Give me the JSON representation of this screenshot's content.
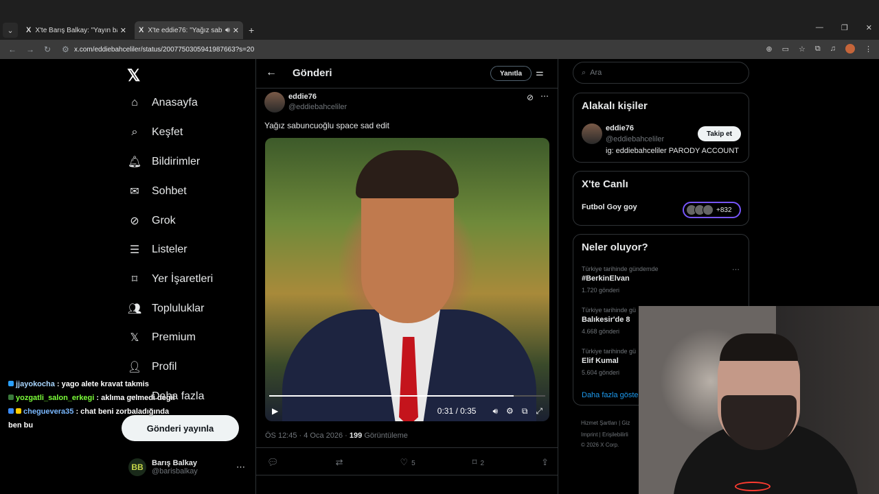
{
  "browser": {
    "tabs": [
      {
        "title": "X'te Barış Balkay: \"Yayın başladı",
        "active": false
      },
      {
        "title": "X'te eddie76: \"Yağız sabunc",
        "active": true
      }
    ],
    "url": "x.com/eddiebahceliler/status/2007750305941987663?s=20"
  },
  "sidebar": {
    "items": [
      {
        "label": "Anasayfa",
        "icon": "home-icon",
        "glyph": "⌂"
      },
      {
        "label": "Keşfet",
        "icon": "search-icon",
        "glyph": "⌕"
      },
      {
        "label": "Bildirimler",
        "icon": "bell-icon",
        "glyph": "🔔︎"
      },
      {
        "label": "Sohbet",
        "icon": "mail-icon",
        "glyph": "✉"
      },
      {
        "label": "Grok",
        "icon": "grok-icon",
        "glyph": "⊘"
      },
      {
        "label": "Listeler",
        "icon": "list-icon",
        "glyph": "☰"
      },
      {
        "label": "Yer İşaretleri",
        "icon": "bookmark-icon",
        "glyph": "⌑"
      },
      {
        "label": "Topluluklar",
        "icon": "people-icon",
        "glyph": "👥︎"
      },
      {
        "label": "Premium",
        "icon": "x-logo-icon",
        "glyph": "𝕏"
      },
      {
        "label": "Profil",
        "icon": "profile-icon",
        "glyph": "👤︎"
      },
      {
        "label": "Daha fazla",
        "icon": "more-circle-icon",
        "glyph": "⋯"
      }
    ],
    "post_button": "Gönderi yayınla",
    "account": {
      "name": "Barış Balkay",
      "handle": "@barisbalkay",
      "initials": "BB"
    }
  },
  "main": {
    "title": "Gönderi",
    "reply_button": "Yanıtla",
    "author": {
      "name": "eddie76",
      "handle": "@eddiebahceliler"
    },
    "text": "Yağız sabuncuoğlu space sad edit",
    "video": {
      "time": "0:31 / 0:35",
      "progress": 0.886
    },
    "meta": {
      "prefix": "ÖS 12:45 · 4 Oca 2026 · ",
      "views": "199",
      "suffix": " Görüntüleme"
    },
    "actions": {
      "likes": "5",
      "bookmarks": "2"
    }
  },
  "right": {
    "search_placeholder": "Ara",
    "related": {
      "title": "Alakalı kişiler",
      "name": "eddie76",
      "handle": "@eddiebahceliler",
      "bio": "ig: eddiebahceliler PARODY ACCOUNT",
      "follow": "Takip et"
    },
    "live": {
      "title": "X'te Canlı",
      "name": "Futbol Goy goy",
      "count": "+832"
    },
    "trends": {
      "title": "Neler oluyor?",
      "items": [
        {
          "context": "Türkiye tarihinde gündemde",
          "name": "#BerkinElvan",
          "count": "1.720 gönderi"
        },
        {
          "context": "Türkiye tarihinde gü",
          "name": "Balıkesir'de 8",
          "count": "4.668 gönderi"
        },
        {
          "context": "Türkiye tarihinde gü",
          "name": "Elif Kumal",
          "count": "5.604 gönderi"
        }
      ],
      "show_more": "Daha fazla göste"
    },
    "footer": [
      "Hizmet Şartları  |  Giz",
      "Imprint  |  Erişilebilirli",
      "© 2026 X Corp."
    ]
  },
  "chat": [
    {
      "user": "jjayokocha",
      "msg": " : yago alete kravat takmis"
    },
    {
      "user": "yozgatli_salon_erkegi",
      "msg": " : aklıma gelmedi degil"
    },
    {
      "user": "cheguevera35",
      "msg": " : chat beni zorbaladığında"
    },
    {
      "user": "",
      "msg": "ben bu"
    }
  ]
}
